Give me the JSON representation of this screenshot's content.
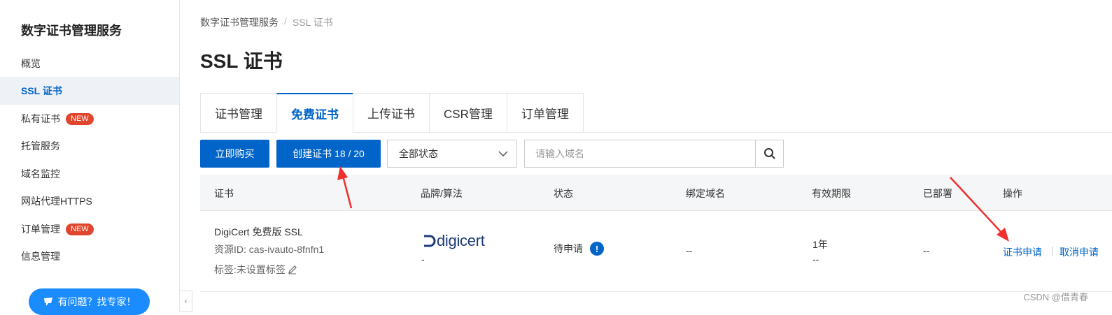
{
  "sidebar": {
    "title": "数字证书管理服务",
    "items": [
      {
        "label": "概览"
      },
      {
        "label": "SSL 证书"
      },
      {
        "label": "私有证书",
        "badge": "NEW"
      },
      {
        "label": "托管服务"
      },
      {
        "label": "域名监控"
      },
      {
        "label": "网站代理HTTPS"
      },
      {
        "label": "订单管理",
        "badge": "NEW"
      },
      {
        "label": "信息管理"
      }
    ],
    "help_label": "有问题？找专家！"
  },
  "breadcrumb": {
    "root": "数字证书管理服务",
    "sep": "/",
    "current": "SSL 证书"
  },
  "page_title": "SSL 证书",
  "tabs": [
    {
      "label": "证书管理"
    },
    {
      "label": "免费证书"
    },
    {
      "label": "上传证书"
    },
    {
      "label": "CSR管理"
    },
    {
      "label": "订单管理"
    }
  ],
  "toolbar": {
    "buy_label": "立即购买",
    "create_label": "创建证书 18 / 20",
    "status_select": "全部状态",
    "search_placeholder": "请输入域名"
  },
  "table": {
    "headers": [
      "证书",
      "品牌/算法",
      "状态",
      "绑定域名",
      "有效期限",
      "已部署",
      "操作"
    ],
    "row": {
      "name": "DigiCert 免费版 SSL",
      "resource_id": "资源ID: cas-ivauto-8fnfn1",
      "tags": "标签:未设置标签",
      "brand": "digicert",
      "algorithm": "-",
      "status": "待申请",
      "status_icon": "!",
      "domain": "--",
      "validity": "1年",
      "validity_sub": "--",
      "deployed": "--",
      "action_apply": "证书申请",
      "action_sep": "|",
      "action_cancel": "取消申请"
    }
  },
  "watermark": "CSDN @借青春",
  "colors": {
    "primary": "#0064c8",
    "badge": "#e0452d",
    "help": "#1a8cff",
    "arrow": "#f03030"
  }
}
